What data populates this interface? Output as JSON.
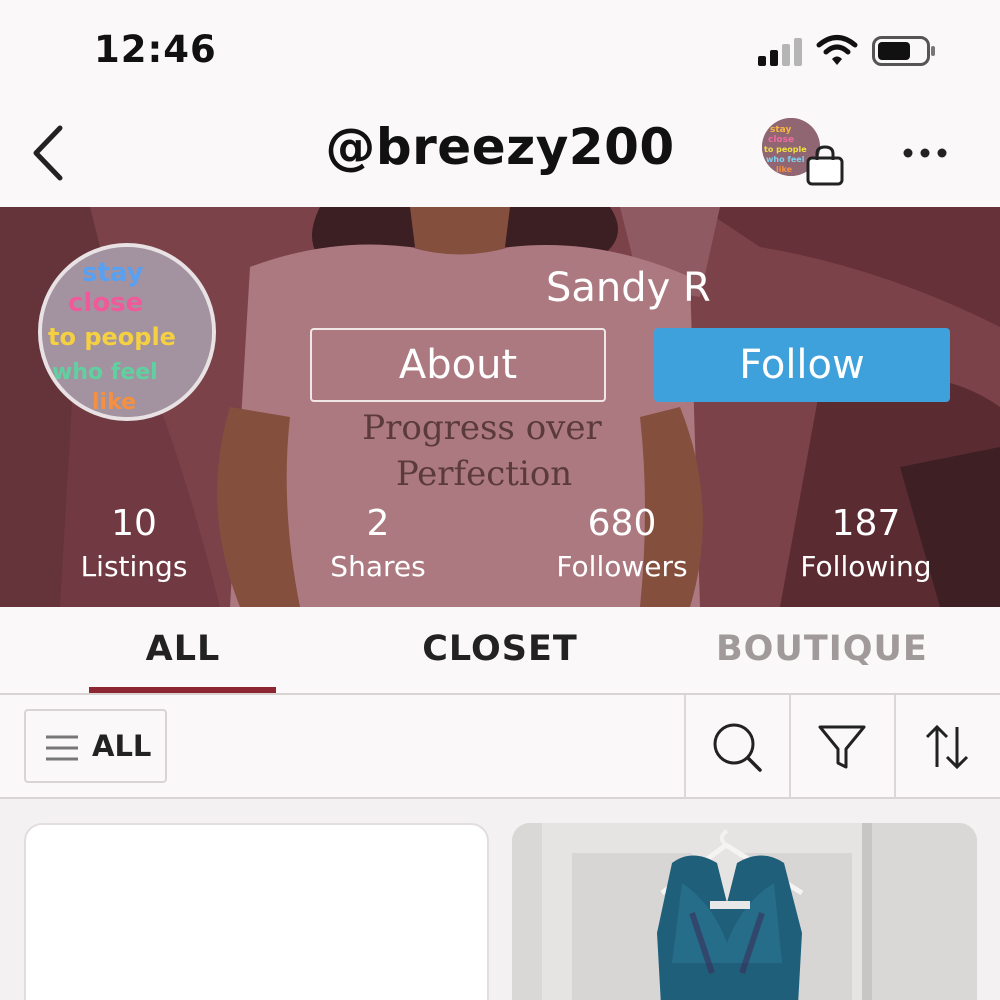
{
  "status_bar": {
    "time": "12:46"
  },
  "header": {
    "handle": "@breezy200"
  },
  "profile": {
    "display_name": "Sandy R",
    "about_label": "About",
    "follow_label": "Follow",
    "avatar_text": [
      "stay",
      "close",
      "to people",
      "who feel",
      "like"
    ],
    "banner_shirt_text": [
      "Progress over",
      "Perfection"
    ],
    "stats": [
      {
        "value": "10",
        "label": "Listings"
      },
      {
        "value": "2",
        "label": "Shares"
      },
      {
        "value": "680",
        "label": "Followers"
      },
      {
        "value": "187",
        "label": "Following"
      }
    ]
  },
  "tabs": [
    {
      "label": "ALL",
      "active": true
    },
    {
      "label": "CLOSET",
      "active": false
    },
    {
      "label": "BOUTIQUE",
      "active": false
    }
  ],
  "toolbar": {
    "filter_label": "ALL"
  },
  "colors": {
    "accent_underline": "#8c2632",
    "follow_button": "#3fa1db",
    "banner_base": "#7a4249"
  },
  "icons": [
    "back-arrow-icon",
    "shopping-bag-icon",
    "more-icon",
    "menu-icon",
    "search-icon",
    "filter-icon",
    "sort-icon",
    "signal-icon",
    "wifi-icon",
    "battery-icon"
  ]
}
